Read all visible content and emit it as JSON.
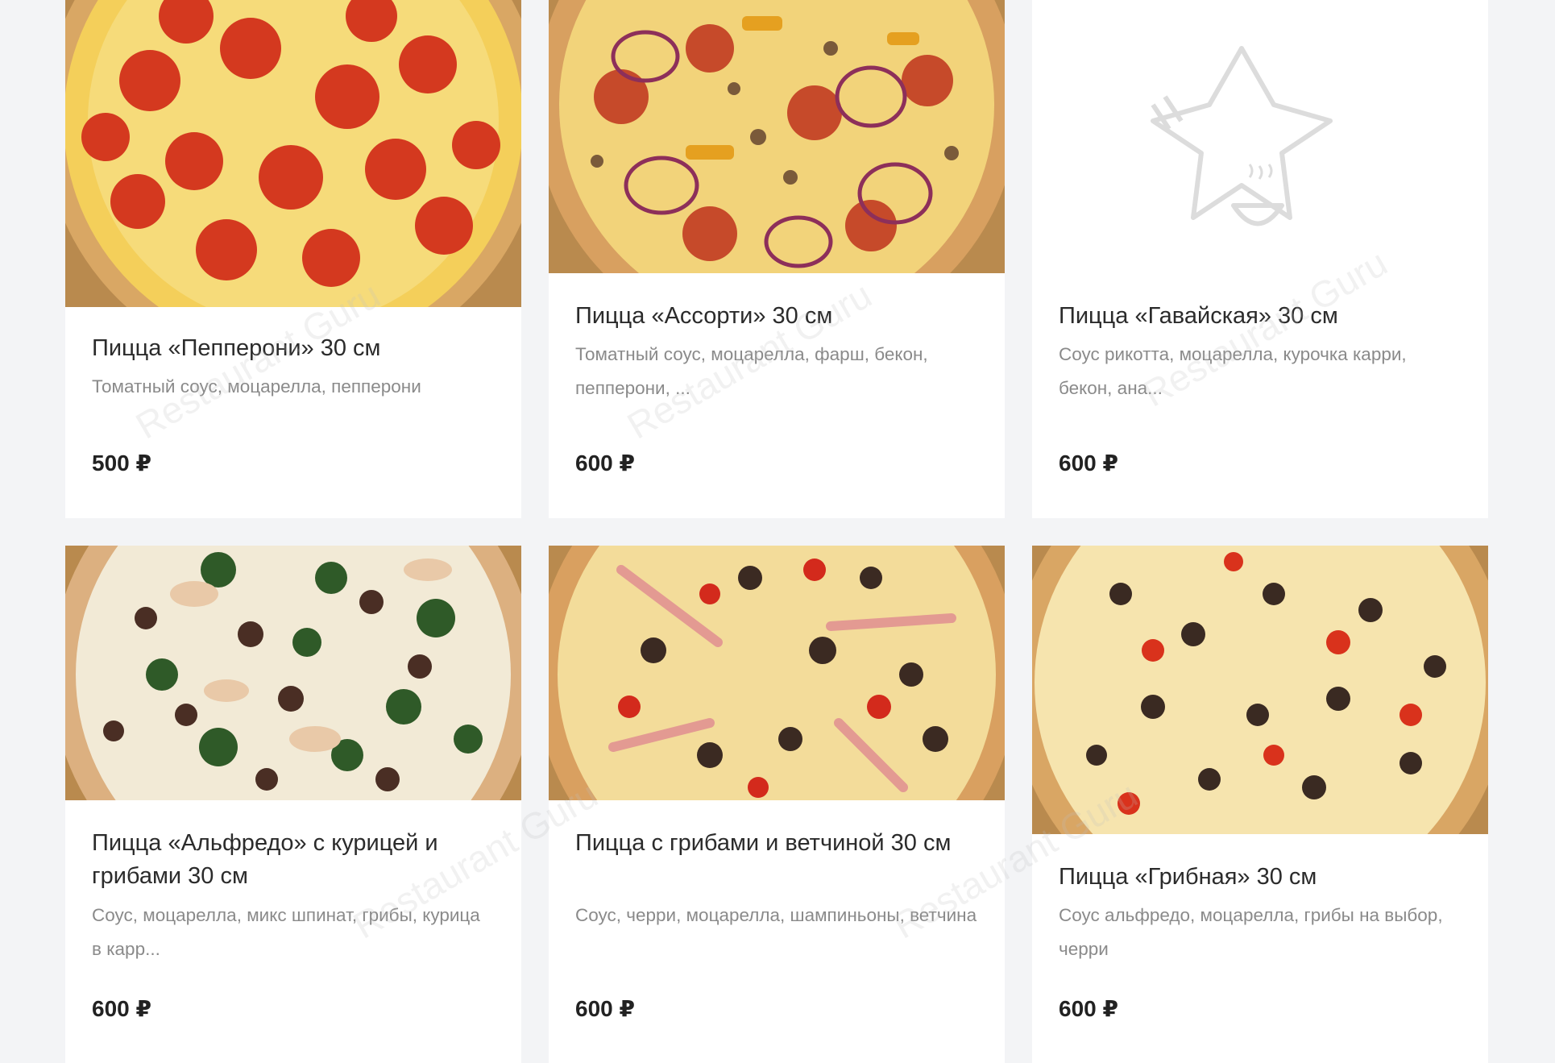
{
  "currency": "₽",
  "watermark": "Restaurant Guru",
  "cards": [
    {
      "title": "Пицца «Пепперони» 30 см",
      "description": "Томатный соус, моцарелла, пепперони",
      "price": "500 ₽",
      "image": "pepperoni-pizza-photo"
    },
    {
      "title": "Пицца «Ассорти» 30 см",
      "description": "Томатный соус, моцарелла, фарш, бекон, пепперони, ...",
      "price": "600 ₽",
      "image": "assorti-pizza-photo"
    },
    {
      "title": "Пицца «Гавайская» 30 см",
      "description": "Соус рикотта, моцарелла, курочка карри, бекон, ана...",
      "price": "600 ₽",
      "image": "placeholder-fork-star-bowl-icon"
    },
    {
      "title": "Пицца «Альфредо» с курицей и грибами 30 см",
      "description": "Соус, моцарелла, микс шпинат, грибы, курица в карр...",
      "price": "600 ₽",
      "image": "alfredo-pizza-photo"
    },
    {
      "title": "Пицца с грибами и ветчиной 30 см",
      "description": "Соус, черри, моцарелла, шампиньоны, ветчина",
      "price": "600 ₽",
      "image": "mushroom-ham-pizza-photo"
    },
    {
      "title": "Пицца «Грибная» 30 см",
      "description": "Соус альфредо, моцарелла, грибы на выбор, черри",
      "price": "600 ₽",
      "image": "mushroom-pizza-photo"
    }
  ]
}
